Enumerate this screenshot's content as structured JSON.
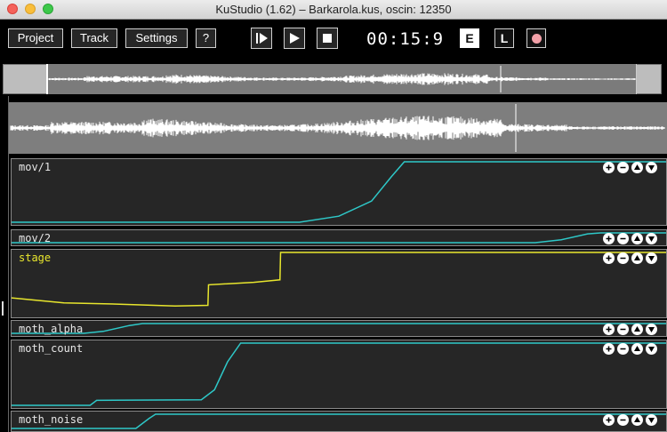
{
  "window": {
    "title": "KuStudio (1.62) – Barkarola.kus, oscin: 12350"
  },
  "toolbar": {
    "project_label": "Project",
    "track_label": "Track",
    "settings_label": "Settings",
    "help_label": "?",
    "time": "00:15:9",
    "mode_e": "E",
    "mode_l": "L"
  },
  "tracks": [
    {
      "name": "mov/1",
      "color": "#2ec8c8",
      "values": [
        [
          0,
          0
        ],
        [
          0.44,
          0
        ],
        [
          0.5,
          0.1
        ],
        [
          0.55,
          0.35
        ],
        [
          0.58,
          0.75
        ],
        [
          0.6,
          1
        ],
        [
          1,
          1
        ]
      ]
    },
    {
      "name": "mov/2",
      "color": "#2ec8c8",
      "values": [
        [
          0,
          0
        ],
        [
          0.8,
          0
        ],
        [
          0.84,
          0.3
        ],
        [
          0.88,
          0.9
        ],
        [
          0.9,
          1
        ],
        [
          1,
          1
        ]
      ]
    },
    {
      "name": "stage",
      "color": "#e8e62d",
      "values": [
        [
          0,
          0.27
        ],
        [
          0.08,
          0.19
        ],
        [
          0.16,
          0.17
        ],
        [
          0.25,
          0.14
        ],
        [
          0.3,
          0.15
        ],
        [
          0.301,
          0.48
        ],
        [
          0.37,
          0.52
        ],
        [
          0.4,
          0.55
        ],
        [
          0.41,
          0.56
        ],
        [
          0.411,
          1
        ],
        [
          1,
          1
        ]
      ]
    },
    {
      "name": "moth_alpha",
      "color": "#2ec8c8",
      "values": [
        [
          0,
          0
        ],
        [
          0.11,
          0
        ],
        [
          0.14,
          0.2
        ],
        [
          0.18,
          0.8
        ],
        [
          0.2,
          1
        ],
        [
          1,
          1
        ]
      ]
    },
    {
      "name": "moth_count",
      "color": "#2ec8c8",
      "values": [
        [
          0,
          0
        ],
        [
          0.12,
          0
        ],
        [
          0.13,
          0.08
        ],
        [
          0.29,
          0.09
        ],
        [
          0.31,
          0.25
        ],
        [
          0.33,
          0.7
        ],
        [
          0.35,
          1
        ],
        [
          1,
          1
        ]
      ]
    },
    {
      "name": "moth_noise",
      "color": "#2ec8c8",
      "values": [
        [
          0,
          0
        ],
        [
          0.19,
          0
        ],
        [
          0.21,
          0.7
        ],
        [
          0.22,
          1
        ],
        [
          1,
          1
        ]
      ]
    }
  ],
  "track_controls": {
    "add": "plus-circle-icon",
    "remove": "minus-circle-icon",
    "up": "arrow-up-circle-icon",
    "down": "arrow-down-circle-icon"
  }
}
